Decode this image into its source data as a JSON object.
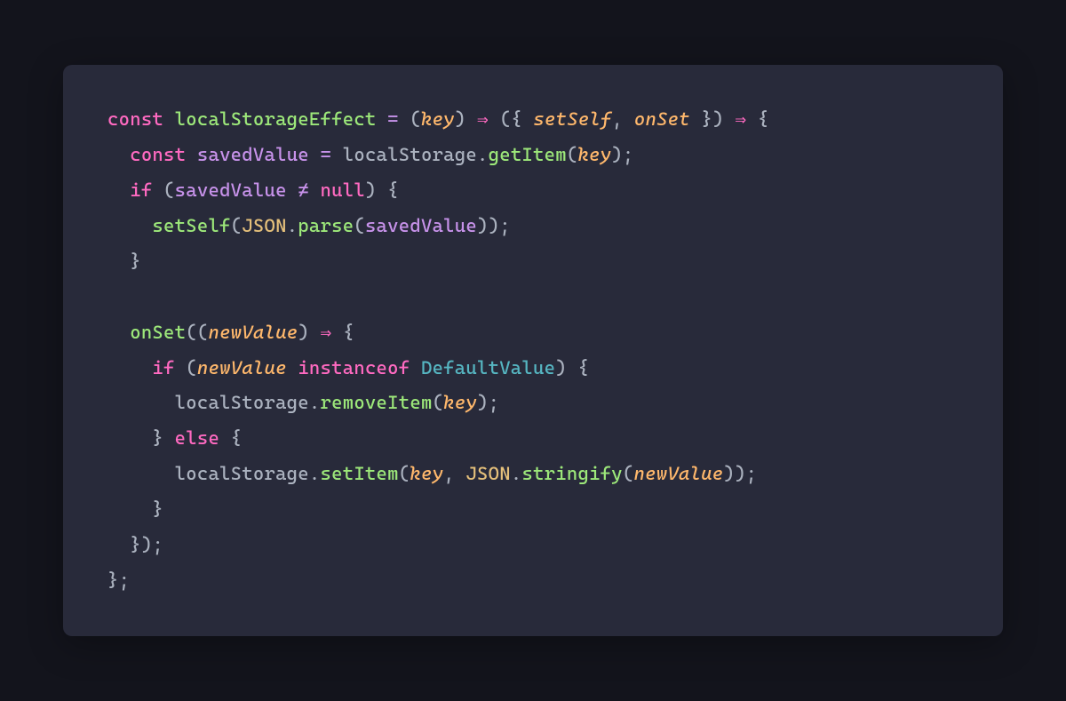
{
  "code": {
    "tokens": [
      {
        "t": "const ",
        "c": "kw"
      },
      {
        "t": "localStorageEffect",
        "c": "fn-dec"
      },
      {
        "t": " ",
        "c": "punc"
      },
      {
        "t": "=",
        "c": "op"
      },
      {
        "t": " ",
        "c": "punc"
      },
      {
        "t": "(",
        "c": "punc"
      },
      {
        "t": "key",
        "c": "param"
      },
      {
        "t": ")",
        "c": "punc"
      },
      {
        "t": " ",
        "c": "punc"
      },
      {
        "t": "⇒",
        "c": "arrow"
      },
      {
        "t": " ",
        "c": "punc"
      },
      {
        "t": "(",
        "c": "punc"
      },
      {
        "t": "{ ",
        "c": "punc"
      },
      {
        "t": "setSelf",
        "c": "param"
      },
      {
        "t": ",",
        "c": "punc"
      },
      {
        "t": " ",
        "c": "punc"
      },
      {
        "t": "onSet",
        "c": "param"
      },
      {
        "t": " }",
        "c": "punc"
      },
      {
        "t": ")",
        "c": "punc"
      },
      {
        "t": " ",
        "c": "punc"
      },
      {
        "t": "⇒",
        "c": "arrow"
      },
      {
        "t": " ",
        "c": "punc"
      },
      {
        "t": "{",
        "c": "punc"
      },
      {
        "t": "\n",
        "c": "punc"
      },
      {
        "t": "  ",
        "c": "punc"
      },
      {
        "t": "const ",
        "c": "kw"
      },
      {
        "t": "savedValue",
        "c": "var"
      },
      {
        "t": " ",
        "c": "punc"
      },
      {
        "t": "=",
        "c": "op"
      },
      {
        "t": " ",
        "c": "punc"
      },
      {
        "t": "localStorage",
        "c": "prop"
      },
      {
        "t": ".",
        "c": "punc"
      },
      {
        "t": "getItem",
        "c": "fn-call"
      },
      {
        "t": "(",
        "c": "punc"
      },
      {
        "t": "key",
        "c": "param"
      },
      {
        "t": ")",
        "c": "punc"
      },
      {
        "t": ";",
        "c": "punc"
      },
      {
        "t": "\n",
        "c": "punc"
      },
      {
        "t": "  ",
        "c": "punc"
      },
      {
        "t": "if ",
        "c": "kw"
      },
      {
        "t": "(",
        "c": "punc"
      },
      {
        "t": "savedValue",
        "c": "var"
      },
      {
        "t": " ",
        "c": "punc"
      },
      {
        "t": "≠",
        "c": "op"
      },
      {
        "t": " ",
        "c": "punc"
      },
      {
        "t": "null",
        "c": "kw"
      },
      {
        "t": ")",
        "c": "punc"
      },
      {
        "t": " ",
        "c": "punc"
      },
      {
        "t": "{",
        "c": "punc"
      },
      {
        "t": "\n",
        "c": "punc"
      },
      {
        "t": "    ",
        "c": "punc"
      },
      {
        "t": "setSelf",
        "c": "fn-call"
      },
      {
        "t": "(",
        "c": "punc"
      },
      {
        "t": "JSON",
        "c": "obj"
      },
      {
        "t": ".",
        "c": "punc"
      },
      {
        "t": "parse",
        "c": "fn-call"
      },
      {
        "t": "(",
        "c": "punc"
      },
      {
        "t": "savedValue",
        "c": "var"
      },
      {
        "t": ")",
        "c": "punc"
      },
      {
        "t": ")",
        "c": "punc"
      },
      {
        "t": ";",
        "c": "punc"
      },
      {
        "t": "\n",
        "c": "punc"
      },
      {
        "t": "  ",
        "c": "punc"
      },
      {
        "t": "}",
        "c": "punc"
      },
      {
        "t": "\n",
        "c": "punc"
      },
      {
        "t": "\n",
        "c": "punc"
      },
      {
        "t": "  ",
        "c": "punc"
      },
      {
        "t": "onSet",
        "c": "fn-call"
      },
      {
        "t": "(",
        "c": "punc"
      },
      {
        "t": "(",
        "c": "punc"
      },
      {
        "t": "newValue",
        "c": "param"
      },
      {
        "t": ")",
        "c": "punc"
      },
      {
        "t": " ",
        "c": "punc"
      },
      {
        "t": "⇒",
        "c": "arrow"
      },
      {
        "t": " ",
        "c": "punc"
      },
      {
        "t": "{",
        "c": "punc"
      },
      {
        "t": "\n",
        "c": "punc"
      },
      {
        "t": "    ",
        "c": "punc"
      },
      {
        "t": "if ",
        "c": "kw"
      },
      {
        "t": "(",
        "c": "punc"
      },
      {
        "t": "newValue",
        "c": "param"
      },
      {
        "t": " ",
        "c": "punc"
      },
      {
        "t": "instanceof ",
        "c": "kw"
      },
      {
        "t": "DefaultValue",
        "c": "type"
      },
      {
        "t": ")",
        "c": "punc"
      },
      {
        "t": " ",
        "c": "punc"
      },
      {
        "t": "{",
        "c": "punc"
      },
      {
        "t": "\n",
        "c": "punc"
      },
      {
        "t": "      ",
        "c": "punc"
      },
      {
        "t": "localStorage",
        "c": "prop"
      },
      {
        "t": ".",
        "c": "punc"
      },
      {
        "t": "removeItem",
        "c": "fn-call"
      },
      {
        "t": "(",
        "c": "punc"
      },
      {
        "t": "key",
        "c": "param"
      },
      {
        "t": ")",
        "c": "punc"
      },
      {
        "t": ";",
        "c": "punc"
      },
      {
        "t": "\n",
        "c": "punc"
      },
      {
        "t": "    ",
        "c": "punc"
      },
      {
        "t": "}",
        "c": "punc"
      },
      {
        "t": " ",
        "c": "punc"
      },
      {
        "t": "else ",
        "c": "kw"
      },
      {
        "t": "{",
        "c": "punc"
      },
      {
        "t": "\n",
        "c": "punc"
      },
      {
        "t": "      ",
        "c": "punc"
      },
      {
        "t": "localStorage",
        "c": "prop"
      },
      {
        "t": ".",
        "c": "punc"
      },
      {
        "t": "setItem",
        "c": "fn-call"
      },
      {
        "t": "(",
        "c": "punc"
      },
      {
        "t": "key",
        "c": "param"
      },
      {
        "t": ",",
        "c": "punc"
      },
      {
        "t": " ",
        "c": "punc"
      },
      {
        "t": "JSON",
        "c": "obj"
      },
      {
        "t": ".",
        "c": "punc"
      },
      {
        "t": "stringify",
        "c": "fn-call"
      },
      {
        "t": "(",
        "c": "punc"
      },
      {
        "t": "newValue",
        "c": "param"
      },
      {
        "t": ")",
        "c": "punc"
      },
      {
        "t": ")",
        "c": "punc"
      },
      {
        "t": ";",
        "c": "punc"
      },
      {
        "t": "\n",
        "c": "punc"
      },
      {
        "t": "    ",
        "c": "punc"
      },
      {
        "t": "}",
        "c": "punc"
      },
      {
        "t": "\n",
        "c": "punc"
      },
      {
        "t": "  ",
        "c": "punc"
      },
      {
        "t": "}",
        "c": "punc"
      },
      {
        "t": ")",
        "c": "punc"
      },
      {
        "t": ";",
        "c": "punc"
      },
      {
        "t": "\n",
        "c": "punc"
      },
      {
        "t": "}",
        "c": "punc"
      },
      {
        "t": ";",
        "c": "punc"
      }
    ]
  },
  "colors": {
    "bg_outer": "#13141c",
    "bg_panel": "#282a3a",
    "keyword": "#ff6ac1",
    "function": "#9de87a",
    "param": "#ffb86c",
    "punctuation": "#abb2bf",
    "operator": "#c792ea",
    "variable": "#c792ea",
    "object": "#e5c07b",
    "type": "#56b6c2"
  }
}
